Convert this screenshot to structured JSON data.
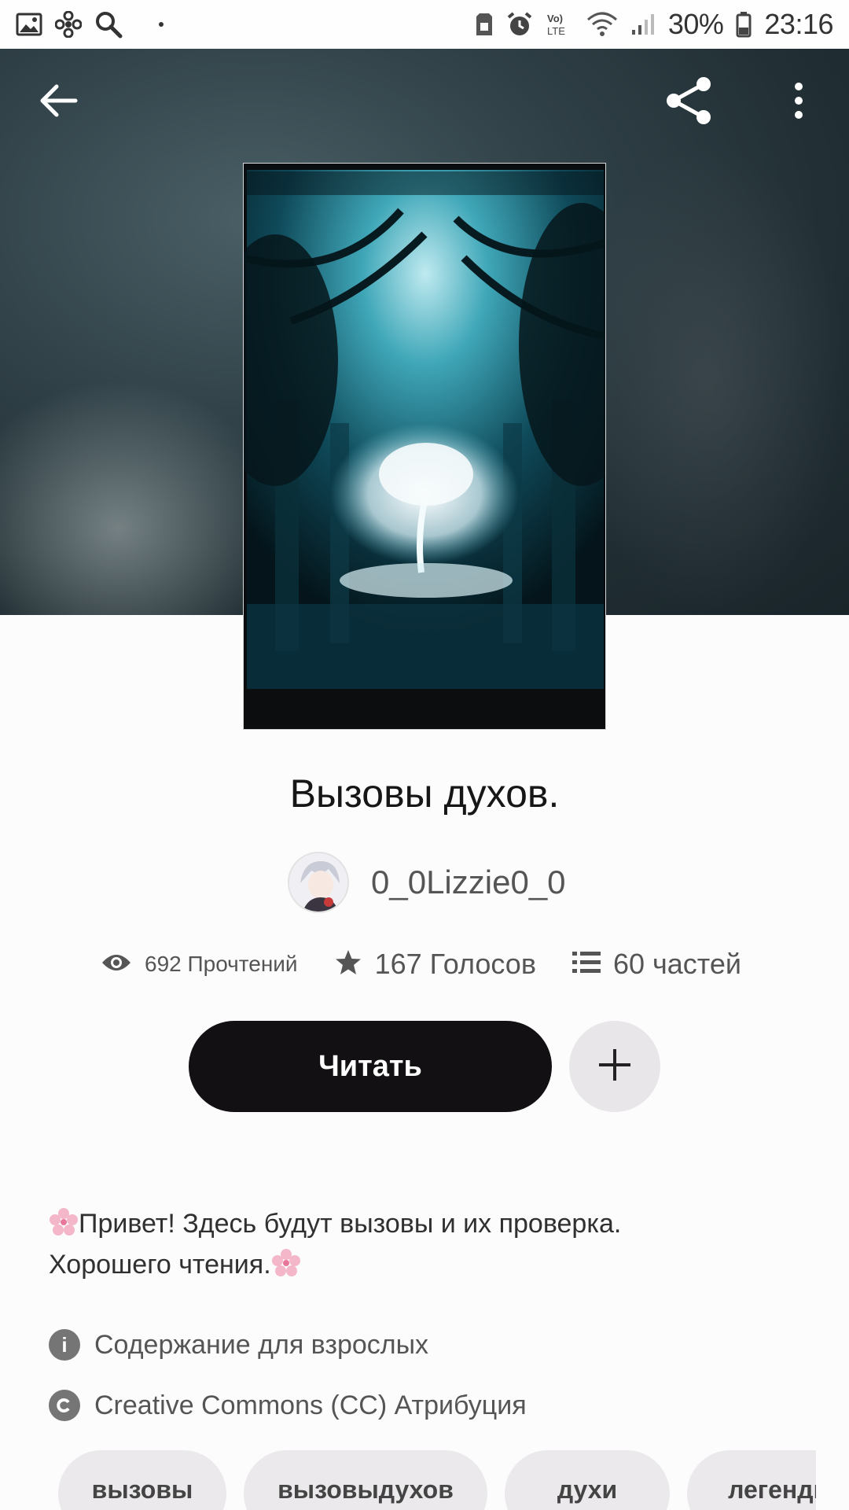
{
  "status_bar": {
    "battery": "30%",
    "time": "23:16",
    "network": "VoLTE"
  },
  "header": {
    "icons": [
      "back-arrow-icon",
      "share-icon",
      "more-vertical-icon"
    ]
  },
  "story": {
    "title": "Вызовы духов.",
    "author": "0_0Lizzie0_0",
    "reads": "692 Прочтений",
    "votes": "167 Голосов",
    "parts": "60 частей",
    "read_label": "Читать",
    "description_line1": "Привет! Здесь будут вызовы и их проверка.",
    "description_line2": "Хорошего чтения.",
    "mature_label": "Содержание для взрослых",
    "license_label": "Creative Commons (CC) Атрибуция",
    "tags": [
      "вызовы",
      "вызовыдухов",
      "духи",
      "легенды"
    ]
  },
  "colors": {
    "read_button": "#121012",
    "add_button": "#e8e6e9",
    "tag_bg": "#ebe9ec",
    "hero_bg": "#2e3f45"
  }
}
